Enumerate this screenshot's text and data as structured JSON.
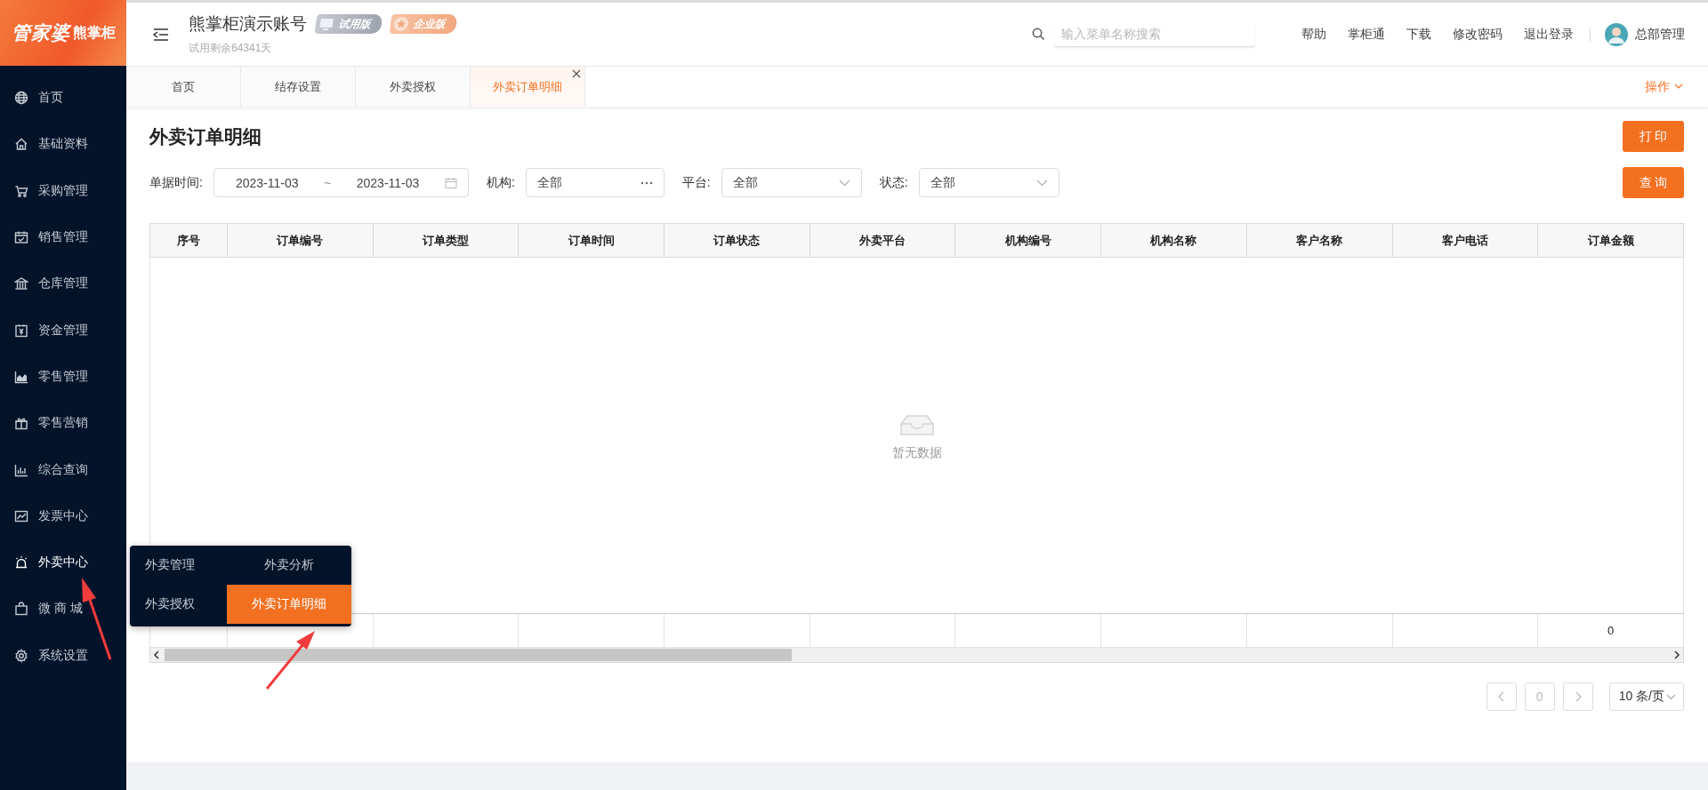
{
  "logo": {
    "main": "管家婆",
    "sub": "熊掌柜"
  },
  "sidebar": {
    "items": [
      {
        "label": "首页",
        "selected": false
      },
      {
        "label": "基础资料",
        "selected": false
      },
      {
        "label": "采购管理",
        "selected": false
      },
      {
        "label": "销售管理",
        "selected": false
      },
      {
        "label": "仓库管理",
        "selected": false
      },
      {
        "label": "资金管理",
        "selected": false
      },
      {
        "label": "零售管理",
        "selected": false
      },
      {
        "label": "零售营销",
        "selected": false
      },
      {
        "label": "综合查询",
        "selected": false
      },
      {
        "label": "发票中心",
        "selected": false
      },
      {
        "label": "外卖中心",
        "selected": true
      },
      {
        "label": "微 商 城",
        "selected": false
      },
      {
        "label": "系统设置",
        "selected": false
      }
    ]
  },
  "submenu": {
    "items": [
      {
        "label": "外卖管理",
        "selected": false
      },
      {
        "label": "外卖分析",
        "selected": false
      },
      {
        "label": "外卖授权",
        "selected": false
      },
      {
        "label": "外卖订单明细",
        "selected": true
      }
    ]
  },
  "header": {
    "account": "熊掌柜演示账号",
    "badges": [
      {
        "label": "试用版",
        "kind": "trial"
      },
      {
        "label": "企业版",
        "kind": "enterprise"
      }
    ],
    "trial_remaining": "试用剩余64341天",
    "search": {
      "placeholder": "输入菜单名称搜索"
    },
    "links": [
      "帮助",
      "掌柜通",
      "下载",
      "修改密码",
      "退出登录"
    ],
    "user": "总部管理"
  },
  "tabs": {
    "items": [
      {
        "label": "首页",
        "selected": false
      },
      {
        "label": "结存设置",
        "selected": false
      },
      {
        "label": "外卖授权",
        "selected": false
      },
      {
        "label": "外卖订单明细",
        "selected": true
      }
    ],
    "actions": "操作"
  },
  "page": {
    "title": "外卖订单明细",
    "print_button": "打 印",
    "query_button": "查 询",
    "filters": [
      {
        "kind": "date_range",
        "label": "单据时间:",
        "start": "2023-11-03",
        "separator": "~",
        "end": "2023-11-03"
      },
      {
        "kind": "picker",
        "label": "机构:",
        "value": "全部"
      },
      {
        "kind": "select",
        "label": "平台:",
        "value": "全部"
      },
      {
        "kind": "select",
        "label": "状态:",
        "value": "全部"
      }
    ]
  },
  "table": {
    "columns": [
      "序号",
      "订单编号",
      "订单类型",
      "订单时间",
      "订单状态",
      "外卖平台",
      "机构编号",
      "机构名称",
      "客户名称",
      "客户电话",
      "订单金额"
    ],
    "empty_text": "暂无数据",
    "total": "0"
  },
  "pagination": {
    "page": "0",
    "page_size": "10 条/页"
  }
}
